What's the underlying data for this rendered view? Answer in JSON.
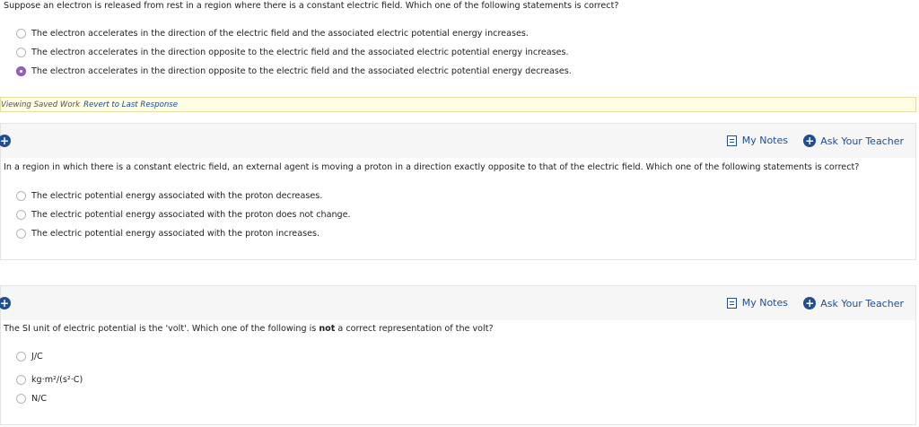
{
  "q1": {
    "prompt": "Suppose an electron is released from rest in a region where there is a constant electric field. Which one of the following statements is correct?",
    "options": [
      {
        "label": "The electron accelerates in the direction of the electric field and the associated electric potential energy increases.",
        "selected": false
      },
      {
        "label": "The electron accelerates in the direction opposite to the electric field and the associated electric potential energy increases.",
        "selected": false
      },
      {
        "label": "The electron accelerates in the direction opposite to the electric field and the associated electric potential energy decreases.",
        "selected": true
      }
    ],
    "saved_text": "Viewing Saved Work",
    "revert_link": "Revert to Last Response"
  },
  "q2": {
    "my_notes": "My Notes",
    "ask_teacher": "Ask Your Teacher",
    "prompt": "In a region in which there is a constant electric field, an external agent is moving a proton in a direction exactly opposite to that of the electric field. Which one of the following statements is correct?",
    "options": [
      {
        "label": "The electric potential energy associated with the proton decreases.",
        "selected": false
      },
      {
        "label": "The electric potential energy associated with the proton does not change.",
        "selected": false
      },
      {
        "label": "The electric potential energy associated with the proton increases.",
        "selected": false
      }
    ]
  },
  "q3": {
    "my_notes": "My Notes",
    "ask_teacher": "Ask Your Teacher",
    "prompt_before": "The SI unit of electric potential is the 'volt'. Which one of the following is ",
    "prompt_bold": "not",
    "prompt_after": " a correct representation of the volt?",
    "options": [
      {
        "label": "J/C",
        "selected": false
      },
      {
        "label": "kg·m²/(s²·C)",
        "selected": false
      },
      {
        "label": "N/C",
        "selected": false
      }
    ]
  },
  "colors": {
    "link_blue": "#1f4f8f",
    "selected_radio": "#9b5fc0",
    "saved_bar_bg": "#fefde1"
  },
  "icons": [
    "expand-plus-icon",
    "notes-icon",
    "add-circle-icon",
    "radio-icon"
  ]
}
